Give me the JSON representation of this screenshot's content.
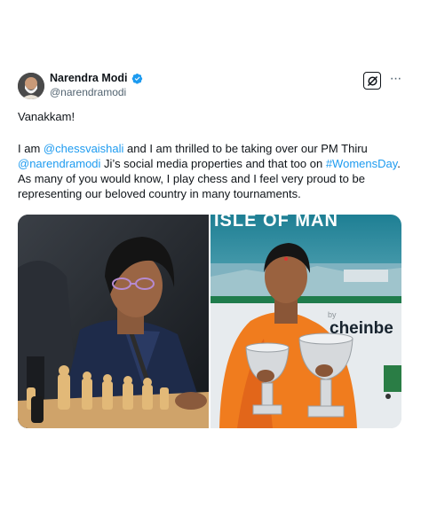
{
  "tweet": {
    "author": {
      "display_name": "Narendra Modi",
      "handle": "@narendramodi",
      "verified": true,
      "badge_color": "#1d9bf0",
      "avatar_icon": "avatar-photo"
    },
    "actions": {
      "grok_icon": "grok-icon",
      "more_icon": "more-horizontal-icon",
      "more_label": "···"
    },
    "text": {
      "greeting": "Vanakkam!",
      "part1": "I am ",
      "mention1": "@chessvaishali",
      "part2": " and I am thrilled to be taking over our PM Thiru ",
      "mention2": "@narendramodi",
      "part3": " Ji’s social media properties and that too on ",
      "hashtag": "#WomensDay",
      "part4": ". As many of you would know, I play chess and I feel very proud to be representing our beloved country in many tournaments.",
      "link_color": "#1d9bf0"
    },
    "media": {
      "right_photo": {
        "banner_text": "ISLE OF MAN",
        "sponsor_by": "by",
        "sponsor_text": "cheinbe"
      }
    }
  }
}
